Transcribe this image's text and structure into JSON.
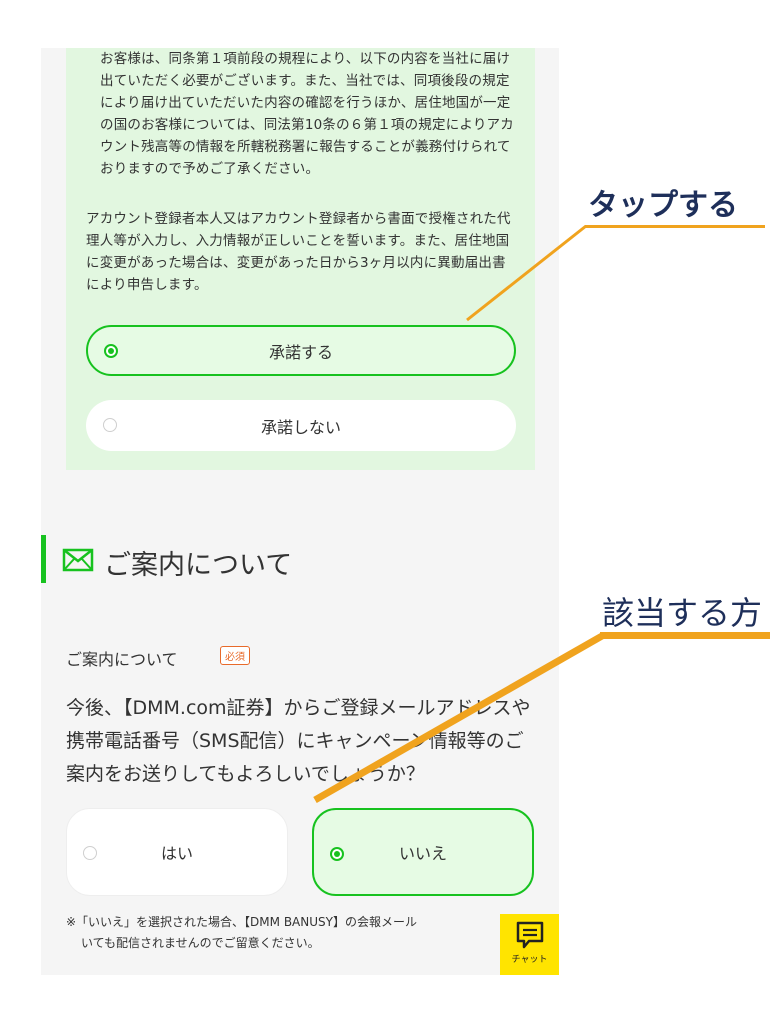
{
  "consent": {
    "indent_text": "お客様は、同条第１項前段の規程により、以下の内容を当社に届け出ていただく必要がございます。また、当社では、同項後段の規定により届け出ていただいた内容の確認を行うほか、居住地国が一定の国のお客様については、同法第10条の６第１項の規定によりアカウント残高等の情報を所轄税務署に報告することが義務付けられておりますので予めご了承ください。",
    "main_text": "アカウント登録者本人又はアカウント登録者から書面で授権された代理人等が入力し、入力情報が正しいことを誓います。また、居住地国に変更があった場合は、変更があった日から3ヶ月以内に異動届出書により申告します。",
    "options": [
      {
        "label": "承諾する",
        "selected": true
      },
      {
        "label": "承諾しない",
        "selected": false
      }
    ]
  },
  "section": {
    "icon": "mail-icon",
    "title": "ご案内について"
  },
  "guidance": {
    "label": "ご案内について",
    "required_badge": "必須",
    "question": "今後、【DMM.com証券】からご登録メールアドレスや携帯電話番号（SMS配信）にキャンペーン情報等のご案内をお送りしてもよろしいでしょうか？",
    "options": [
      {
        "label": "はい",
        "selected": false
      },
      {
        "label": "いいえ",
        "selected": true
      }
    ],
    "note_line1": "※「いいえ」を選択された場合、【DMM BANUSY】の会報メール",
    "note_line2": "いても配信されませんのでご留意ください。"
  },
  "chat": {
    "label": "チャット",
    "icon": "chat-icon"
  },
  "annotations": {
    "tap": "タップする",
    "applicable": "該当する方"
  },
  "colors": {
    "accent_green": "#17c21f",
    "consent_bg": "#e2f7e0",
    "annotation_orange": "#f0a31e",
    "annotation_navy": "#1e2f5a",
    "chat_yellow": "#ffe400",
    "required_orange": "#e86a2a"
  }
}
